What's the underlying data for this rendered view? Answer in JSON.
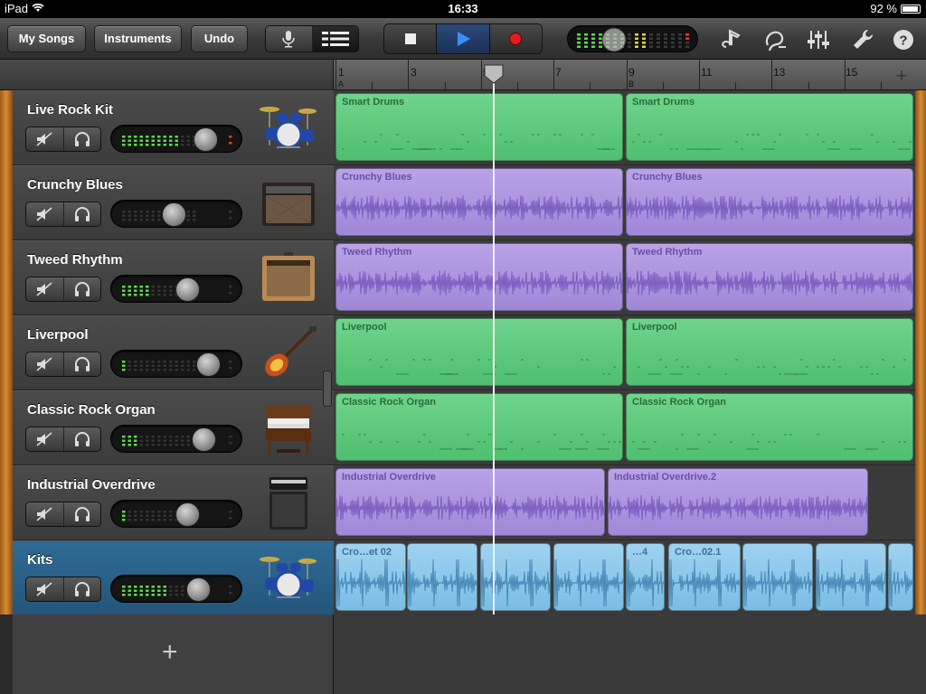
{
  "statusbar": {
    "device": "iPad",
    "time": "16:33",
    "battery": "92 %",
    "battery_level": 0.92
  },
  "toolbar": {
    "my_songs": "My Songs",
    "instruments": "Instruments",
    "undo": "Undo",
    "view_toggle": [
      "mic-icon",
      "tracks-view-icon"
    ],
    "transport": [
      "stop-icon",
      "play-icon",
      "record-icon"
    ],
    "right_icons": [
      "metronome-icon",
      "loop-icon",
      "mixer-icon",
      "settings-wrench-icon",
      "help-icon"
    ],
    "help_glyph": "?"
  },
  "ruler": {
    "bars": [
      "1",
      "3",
      "5",
      "7",
      "9",
      "11",
      "13",
      "15"
    ],
    "markers": [
      "A",
      "B"
    ],
    "add_section": "+"
  },
  "tracks": [
    {
      "name": "Live Rock Kit",
      "icon": "drum-kit-icon",
      "level": 0.75,
      "meter_leds": 10,
      "peak": true,
      "selected": false
    },
    {
      "name": "Crunchy Blues",
      "icon": "amp-icon",
      "level": 0.45,
      "meter_leds": 0,
      "peak": false,
      "selected": false
    },
    {
      "name": "Tweed Rhythm",
      "icon": "tweed-amp-icon",
      "level": 0.58,
      "meter_leds": 5,
      "peak": false,
      "selected": false
    },
    {
      "name": "Liverpool",
      "icon": "bass-guitar-icon",
      "level": 0.78,
      "meter_leds": 1,
      "peak": false,
      "selected": false
    },
    {
      "name": "Classic Rock Organ",
      "icon": "organ-icon",
      "level": 0.73,
      "meter_leds": 3,
      "peak": false,
      "selected": false
    },
    {
      "name": "Industrial Overdrive",
      "icon": "amp-stack-icon",
      "level": 0.58,
      "meter_leds": 1,
      "peak": false,
      "selected": false
    },
    {
      "name": "Kits",
      "icon": "drum-kit-icon",
      "level": 0.68,
      "meter_leds": 8,
      "peak": false,
      "selected": true
    }
  ],
  "regions": [
    [
      {
        "name": "Smart Drums",
        "color": "green"
      },
      {
        "name": "Smart Drums",
        "color": "green"
      }
    ],
    [
      {
        "name": "Crunchy Blues",
        "color": "purple"
      },
      {
        "name": "Crunchy Blues",
        "color": "purple"
      }
    ],
    [
      {
        "name": "Tweed Rhythm",
        "color": "purple"
      },
      {
        "name": "Tweed Rhythm",
        "color": "purple"
      }
    ],
    [
      {
        "name": "Liverpool",
        "color": "green"
      },
      {
        "name": "Liverpool",
        "color": "green"
      }
    ],
    [
      {
        "name": "Classic Rock Organ",
        "color": "green"
      },
      {
        "name": "Classic Rock Organ",
        "color": "green"
      }
    ],
    [
      {
        "name": "Industrial Overdrive",
        "color": "purple"
      },
      {
        "name": "Industrial Overdrive.2",
        "color": "purple"
      }
    ],
    [
      {
        "name": "Cro…et 02",
        "color": "blue"
      },
      {
        "name": "",
        "color": "blue"
      },
      {
        "name": "",
        "color": "blue"
      },
      {
        "name": "",
        "color": "blue"
      },
      {
        "name": "…4",
        "color": "blue"
      },
      {
        "name": "Cro…02.1",
        "color": "blue"
      },
      {
        "name": "",
        "color": "blue"
      },
      {
        "name": "",
        "color": "blue"
      },
      {
        "name": "",
        "color": "blue"
      }
    ]
  ],
  "add_track_glyph": "+",
  "colors": {
    "green_region": "#5cc97c",
    "purple_region": "#ab92dd",
    "blue_region": "#8cc6ea",
    "selected_track": "#2a5f86",
    "meter_green": "#5bd94a",
    "meter_red": "#e53b2a"
  }
}
